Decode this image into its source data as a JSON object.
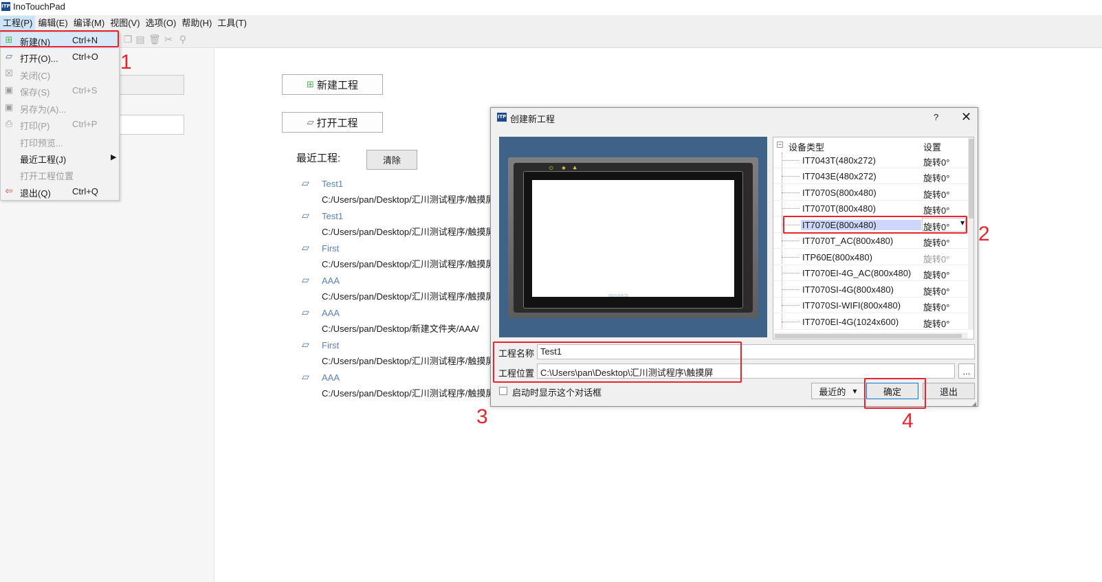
{
  "app": {
    "title": "InoTouchPad",
    "logo_text": "ITP"
  },
  "menubar": [
    {
      "label": "工程(P)"
    },
    {
      "label": "编辑(E)"
    },
    {
      "label": "编译(M)"
    },
    {
      "label": "视图(V)"
    },
    {
      "label": "选项(O)"
    },
    {
      "label": "帮助(H)"
    },
    {
      "label": "工具(T)"
    }
  ],
  "file_menu": [
    {
      "label": "新建(N)",
      "key": "Ctrl+N",
      "icon": "new-file-icon"
    },
    {
      "label": "打开(O)...",
      "key": "Ctrl+O",
      "icon": "open-folder-icon"
    },
    {
      "label": "关闭(C)",
      "key": "",
      "icon": "close-project-icon"
    },
    {
      "label": "保存(S)",
      "key": "Ctrl+S",
      "icon": "save-icon"
    },
    {
      "label": "另存为(A)...",
      "key": "",
      "icon": "save-as-icon"
    },
    {
      "label": "打印(P)",
      "key": "Ctrl+P",
      "icon": "print-icon"
    },
    {
      "label": "打印预览...",
      "key": ""
    },
    {
      "label": "最近工程(J)",
      "key": ""
    },
    {
      "label": "打开工程位置",
      "key": ""
    },
    {
      "label": "退出(Q)",
      "key": "Ctrl+Q",
      "icon": "exit-icon"
    }
  ],
  "start_page": {
    "new_project": "新建工程",
    "open_project": "打开工程",
    "recent_label": "最近工程:",
    "clear": "清除",
    "recent": [
      {
        "name": "Test1",
        "path": "C:/Users/pan/Desktop/汇川测试程序/触摸屏"
      },
      {
        "name": "Test1",
        "path": "C:/Users/pan/Desktop/汇川测试程序/触摸屏"
      },
      {
        "name": "First",
        "path": "C:/Users/pan/Desktop/汇川测试程序/触摸屏"
      },
      {
        "name": "AAA",
        "path": "C:/Users/pan/Desktop/汇川测试程序/触摸屏"
      },
      {
        "name": "AAA",
        "path": "C:/Users/pan/Desktop/新建文件夹/AAA/"
      },
      {
        "name": "First",
        "path": "C:/Users/pan/Desktop/汇川测试程序/触摸屏"
      },
      {
        "name": "AAA",
        "path": "C:/Users/pan/Desktop/汇川测试程序/触摸屏"
      }
    ]
  },
  "dialog": {
    "title": "创建新工程",
    "help": "?",
    "close": "✕",
    "preview_brand": "INOVANCE",
    "tree_header_type": "设备类型",
    "tree_header_setting": "设置",
    "devices": [
      {
        "name": "IT7043T(480x272)",
        "setting": "旋转0°"
      },
      {
        "name": "IT7043E(480x272)",
        "setting": "旋转0°"
      },
      {
        "name": "IT7070S(800x480)",
        "setting": "旋转0°"
      },
      {
        "name": "IT7070T(800x480)",
        "setting": "旋转0°"
      },
      {
        "name": "IT7070E(800x480)",
        "setting": "旋转0°"
      },
      {
        "name": "IT7070T_AC(800x480)",
        "setting": "旋转0°"
      },
      {
        "name": "ITP60E(800x480)",
        "setting": "旋转0°"
      },
      {
        "name": "IT7070EI-4G_AC(800x480)",
        "setting": "旋转0°"
      },
      {
        "name": "IT7070SI-4G(800x480)",
        "setting": "旋转0°"
      },
      {
        "name": "IT7070SI-WIFI(800x480)",
        "setting": "旋转0°"
      },
      {
        "name": "IT7070EI-4G(1024x600)",
        "setting": "旋转0°"
      }
    ],
    "project_name_label": "工程名称",
    "project_name_value": "Test1",
    "project_location_label": "工程位置",
    "project_location_value": "C:\\Users\\pan\\Desktop\\汇川测试程序\\触摸屏",
    "browse": "...",
    "show_on_start": "启动时显示这个对话框",
    "recent_btn": "最近的",
    "ok_btn": "确定",
    "exit_btn": "退出"
  },
  "annotations": {
    "n1": "1",
    "n2": "2",
    "n3": "3",
    "n4": "4"
  },
  "colors": {
    "annotation_red": "#e8232b",
    "menu_highlight": "#cde4f7",
    "selection": "#ccd7fb",
    "link_blue": "#5b7fb6"
  }
}
